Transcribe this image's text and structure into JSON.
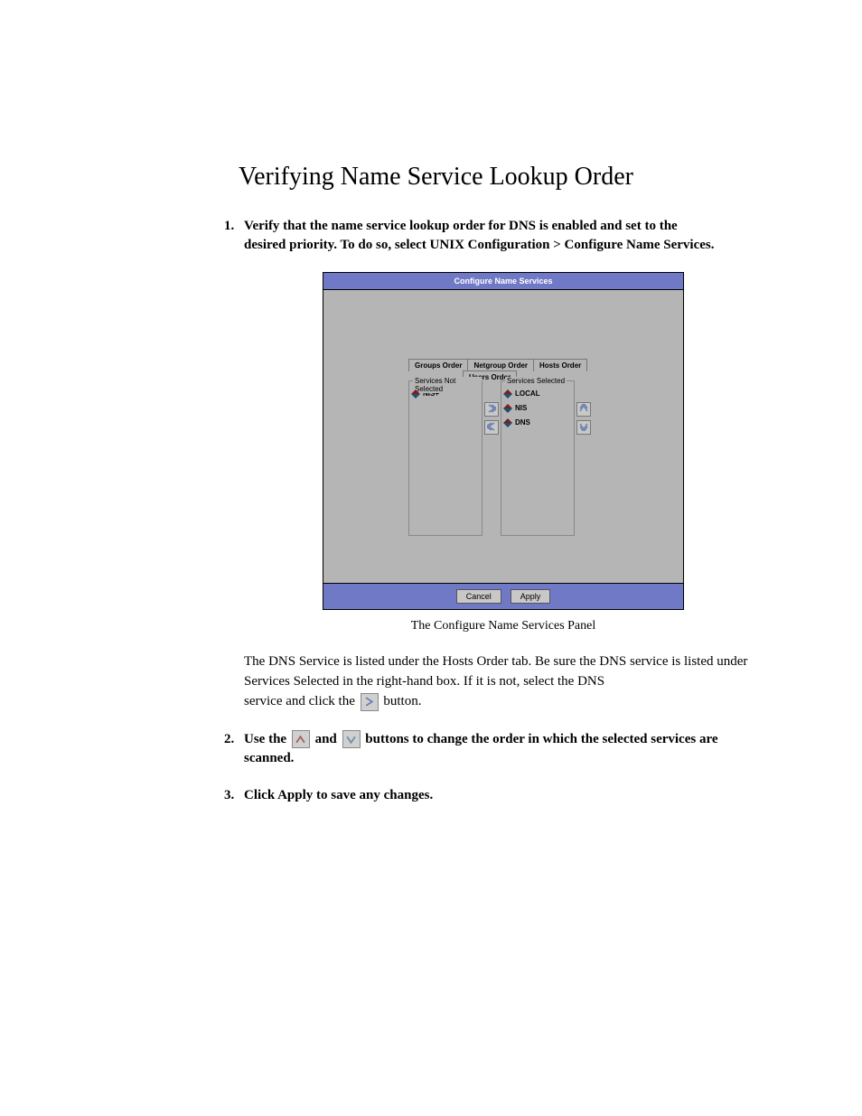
{
  "heading": "Verifying Name Service Lookup Order",
  "steps": {
    "s1_line1": "Verify that the name service lookup order for DNS is enabled and set to the",
    "s1_line2": "desired priority. To do so, select UNIX Configuration > Configure Name Services.",
    "s2_pre": "Use the ",
    "s2_mid": " and ",
    "s2_post": " buttons to change the order in which the selected services are scanned.",
    "s3": "Click Apply to save any changes."
  },
  "figure_caption": "The Configure Name Services Panel",
  "panel": {
    "title": "Configure Name Services",
    "tabs": {
      "groups": "Groups Order",
      "netgroup": "Netgroup Order",
      "hosts": "Hosts Order",
      "users": "Users Order"
    },
    "not_selected_label": "Services Not Selected",
    "selected_label": "Services Selected",
    "not_selected_items": [
      "NIS+"
    ],
    "selected_items": [
      "LOCAL",
      "NIS",
      "DNS"
    ],
    "buttons": {
      "cancel": "Cancel",
      "apply": "Apply"
    }
  },
  "para": {
    "p1": "The DNS Service is listed under the Hosts Order tab. Be sure the DNS service is listed under Services Selected in the right-hand box. If it is not, select the DNS",
    "p2_pre": "service and click the ",
    "p2_post": " button."
  }
}
